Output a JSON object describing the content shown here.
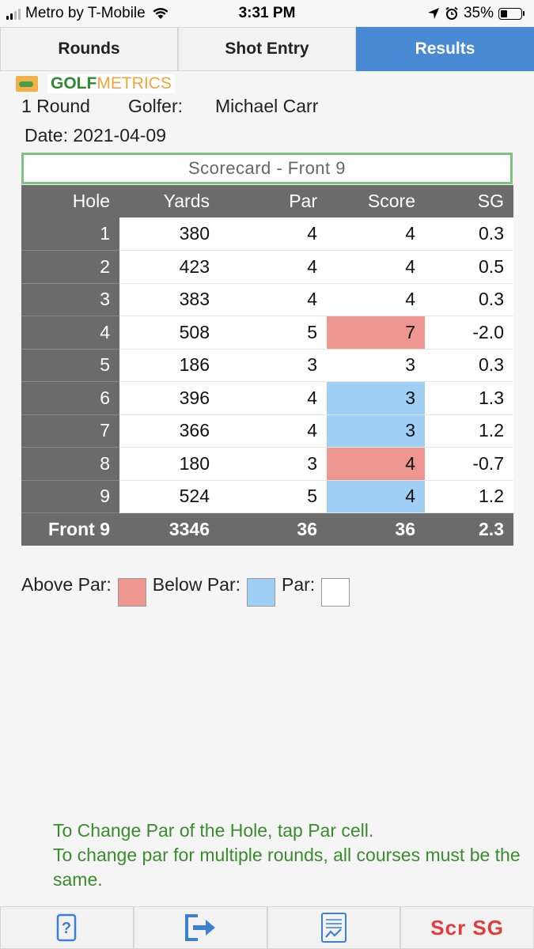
{
  "status_bar": {
    "carrier": "Metro by T-Mobile",
    "time": "3:31 PM",
    "battery": "35%",
    "battery_level": 0.35
  },
  "tabs": [
    {
      "label": "Rounds",
      "active": false
    },
    {
      "label": "Shot Entry",
      "active": false
    },
    {
      "label": "Results",
      "active": true
    }
  ],
  "header": {
    "logo_bold": "GOLF",
    "logo_light": "METRICS",
    "rounds": "1 Round",
    "golfer_label": "Golfer:",
    "golfer_name": "Michael Carr",
    "date": "Date: 2021-04-09"
  },
  "scorecard": {
    "title": "Scorecard - Front 9",
    "columns": [
      "Hole",
      "Yards",
      "Par",
      "Score",
      "SG"
    ],
    "rows": [
      {
        "hole": "1",
        "yards": "380",
        "par": "4",
        "score": "4",
        "sg": "0.3",
        "status": "par"
      },
      {
        "hole": "2",
        "yards": "423",
        "par": "4",
        "score": "4",
        "sg": "0.5",
        "status": "par"
      },
      {
        "hole": "3",
        "yards": "383",
        "par": "4",
        "score": "4",
        "sg": "0.3",
        "status": "par"
      },
      {
        "hole": "4",
        "yards": "508",
        "par": "5",
        "score": "7",
        "sg": "-2.0",
        "status": "above"
      },
      {
        "hole": "5",
        "yards": "186",
        "par": "3",
        "score": "3",
        "sg": "0.3",
        "status": "par"
      },
      {
        "hole": "6",
        "yards": "396",
        "par": "4",
        "score": "3",
        "sg": "1.3",
        "status": "below"
      },
      {
        "hole": "7",
        "yards": "366",
        "par": "4",
        "score": "3",
        "sg": "1.2",
        "status": "below"
      },
      {
        "hole": "8",
        "yards": "180",
        "par": "3",
        "score": "4",
        "sg": "-0.7",
        "status": "above"
      },
      {
        "hole": "9",
        "yards": "524",
        "par": "5",
        "score": "4",
        "sg": "1.2",
        "status": "below"
      }
    ],
    "total": {
      "hole": "Front 9",
      "yards": "3346",
      "par": "36",
      "score": "36",
      "sg": "2.3"
    }
  },
  "legend": {
    "above_label": "Above Par:",
    "below_label": "Below Par:",
    "par_label": "Par:",
    "above_color": "#ee9690",
    "below_color": "#9fcff5",
    "par_color": "#ffffff"
  },
  "note": {
    "line1": "To Change Par of the Hole, tap Par cell.",
    "line2": "To change par for multiple rounds, all courses must be the same."
  },
  "toolbar": {
    "help_icon": "help-icon",
    "export_icon": "export-icon",
    "report_icon": "report-icon",
    "scr_sg_label": "Scr SG"
  }
}
